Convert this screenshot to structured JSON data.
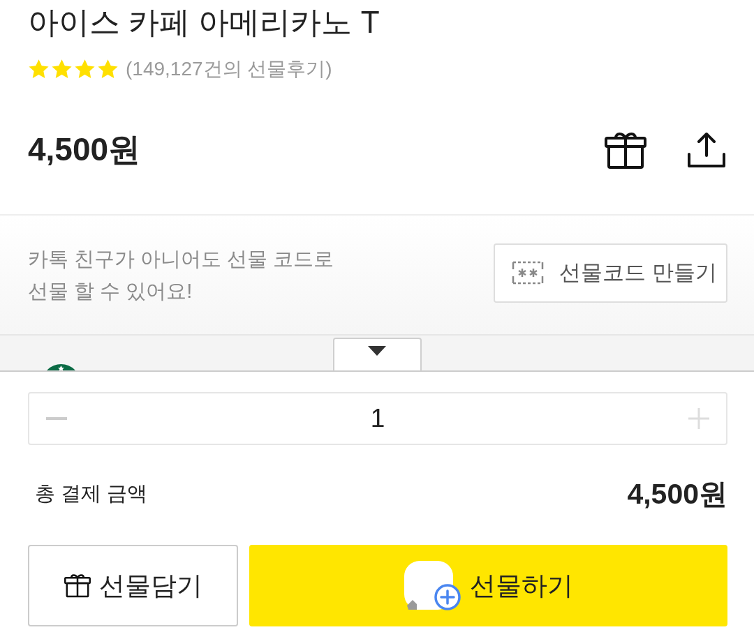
{
  "product": {
    "title": "아이스 카페 아메리카노 T",
    "stars": 4,
    "review_count": "(149,127건의 선물후기)",
    "price": "4,500원"
  },
  "gift_code": {
    "message_lines": [
      "카톡 친구가 아니어도 선물 코드로",
      "선물 할 수 있어요!"
    ],
    "button": "선물코드 만들기"
  },
  "quantity": {
    "value": "1"
  },
  "total": {
    "label": "총 결제 금액",
    "amount": "4,500원"
  },
  "actions": [
    {
      "kind": "cart",
      "label": "선물담기"
    },
    {
      "kind": "gift",
      "label": "선물하기"
    }
  ]
}
